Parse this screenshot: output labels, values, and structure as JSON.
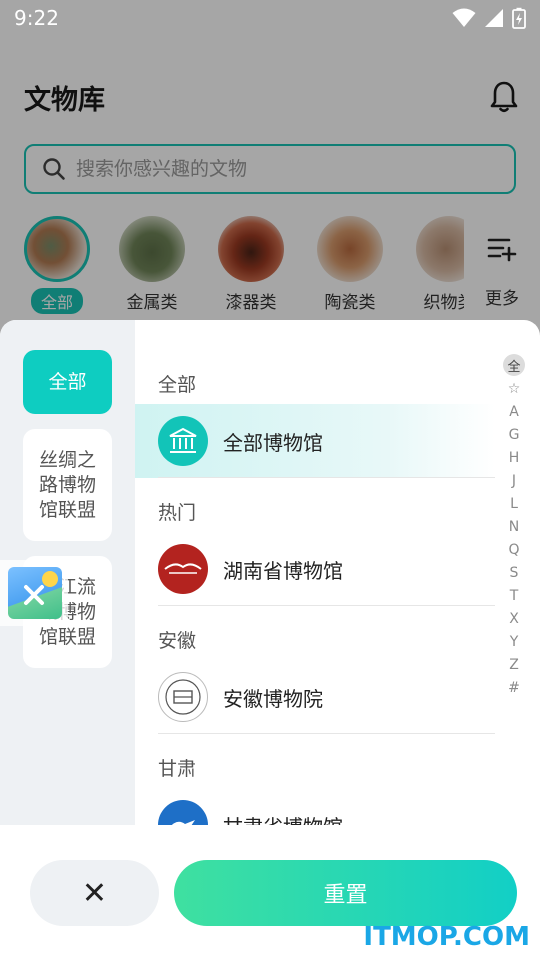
{
  "status": {
    "time": "9:22"
  },
  "header": {
    "title": "文物库"
  },
  "search": {
    "placeholder": "搜索你感兴趣的文物"
  },
  "categories": [
    {
      "label": "全部",
      "active": true
    },
    {
      "label": "金属类",
      "active": false
    },
    {
      "label": "漆器类",
      "active": false
    },
    {
      "label": "陶瓷类",
      "active": false
    },
    {
      "label": "织物类",
      "active": false
    }
  ],
  "more": {
    "label": "更多"
  },
  "sheet": {
    "left_items": [
      {
        "label": "全部",
        "active": true
      },
      {
        "label": "丝绸之路博物馆联盟",
        "active": false
      },
      {
        "label": "长江流域博物馆联盟",
        "active": false
      }
    ],
    "sections": [
      {
        "title": "全部",
        "items": [
          {
            "label": "全部博物馆",
            "active": true,
            "icon": "museum-icon"
          }
        ]
      },
      {
        "title": "热门",
        "items": [
          {
            "label": "湖南省博物馆",
            "active": false,
            "icon": "hunan-museum-logo"
          }
        ]
      },
      {
        "title": "安徽",
        "items": [
          {
            "label": "安徽博物院",
            "active": false,
            "icon": "anhui-museum-logo"
          }
        ]
      },
      {
        "title": "甘肃",
        "items": [
          {
            "label": "甘肃省博物馆",
            "active": false,
            "icon": "gansu-museum-logo"
          }
        ]
      }
    ],
    "index_letters": [
      "全",
      "☆",
      "A",
      "G",
      "H",
      "J",
      "L",
      "N",
      "Q",
      "S",
      "T",
      "X",
      "Y",
      "Z",
      "#"
    ]
  },
  "buttons": {
    "close": "✕",
    "reset": "重置"
  },
  "watermark": "ITMOP.COM",
  "colors": {
    "accent": "#19c2b4",
    "reset_gradient_start": "#3fe0a0",
    "reset_gradient_end": "#12cfc6",
    "watermark": "#1aa7e6"
  }
}
